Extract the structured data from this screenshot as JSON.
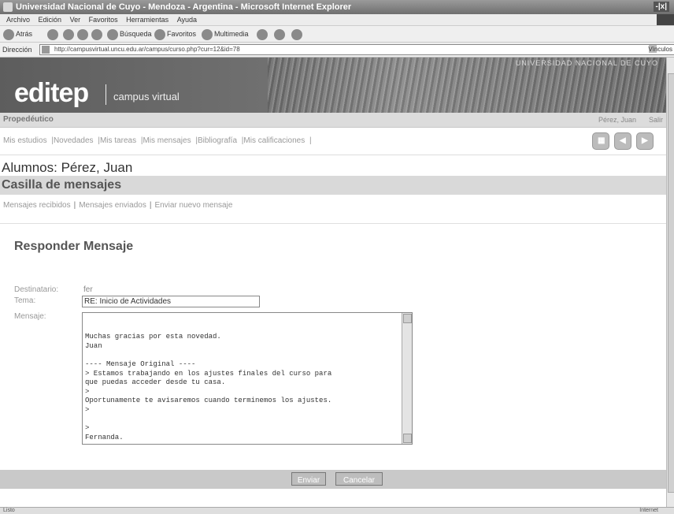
{
  "window": {
    "title": "Universidad Nacional de Cuyo - Mendoza - Argentina - Microsoft Internet Explorer",
    "controls": "-|x|"
  },
  "menubar": [
    "Archivo",
    "Edición",
    "Ver",
    "Favoritos",
    "Herramientas",
    "Ayuda"
  ],
  "toolbar": {
    "back": "Atrás",
    "search": "Búsqueda",
    "favorites": "Favoritos",
    "history": "Multimedia"
  },
  "address": {
    "label": "Dirección",
    "url": "http://campusvirtual.uncu.edu.ar/campus/curso.php?cur=12&id=78",
    "links": "Vínculos"
  },
  "banner": {
    "university": "UNIVERSIDAD NACIONAL DE CUYO",
    "logo": "editep",
    "subtitle": "campus virtual"
  },
  "subbar": {
    "course": "Propedéutico",
    "user": "Pérez, Juan",
    "logout": "Salir"
  },
  "nav": {
    "links": [
      "Mis estudios",
      "|Novedades",
      "|Mis tareas",
      "|Mis mensajes",
      "|Bibliografía",
      "|Mis calificaciones",
      "|"
    ]
  },
  "student": "Alumnos: Pérez, Juan",
  "section": "Casilla de mensajes",
  "tabs": {
    "received": "Mensajes recibidos",
    "sent": "Mensajes enviados",
    "new": "Enviar nuevo mensaje",
    "sep": "|"
  },
  "form": {
    "heading": "Responder Mensaje",
    "to_label": "Destinatario:",
    "to_value": "fer",
    "subject_label": "Tema:",
    "subject_value": "RE: Inicio de Actividades",
    "message_label": "Mensaje:",
    "message_body": "Muchas gracias por esta novedad.\nJuan\n\n---- Mensaje Original ----\n> Estamos trabajando en los ajustes finales del curso para\nque puedas acceder desde tu casa.\n>\nOportunamente te avisaremos cuando terminemos los ajustes.\n>\n\n>\nFernanda.",
    "send": "Enviar",
    "cancel": "Cancelar"
  },
  "status": {
    "left": "Listo",
    "zone": "Internet"
  }
}
